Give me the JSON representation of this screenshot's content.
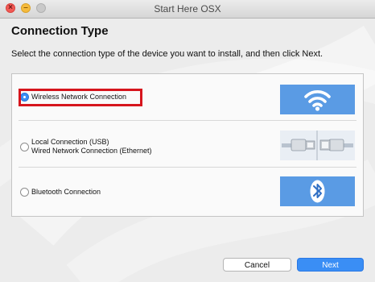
{
  "window": {
    "title": "Start Here OSX"
  },
  "page": {
    "title": "Connection Type",
    "instruction": "Select the connection type of the device you want to install, and then click Next."
  },
  "options": [
    {
      "lines": [
        "Wireless Network Connection"
      ],
      "selected": true,
      "icon": "wifi-icon"
    },
    {
      "lines": [
        "Local Connection (USB)",
        "Wired Network Connection (Ethernet)"
      ],
      "selected": false,
      "icon": "cable-connectors-icon"
    },
    {
      "lines": [
        "Bluetooth Connection"
      ],
      "selected": false,
      "icon": "bluetooth-icon"
    }
  ],
  "buttons": {
    "cancel": "Cancel",
    "next": "Next"
  },
  "colors": {
    "accent": "#3a8ef5",
    "highlight": "#d6151d",
    "image_bg": "#5a9be4"
  }
}
